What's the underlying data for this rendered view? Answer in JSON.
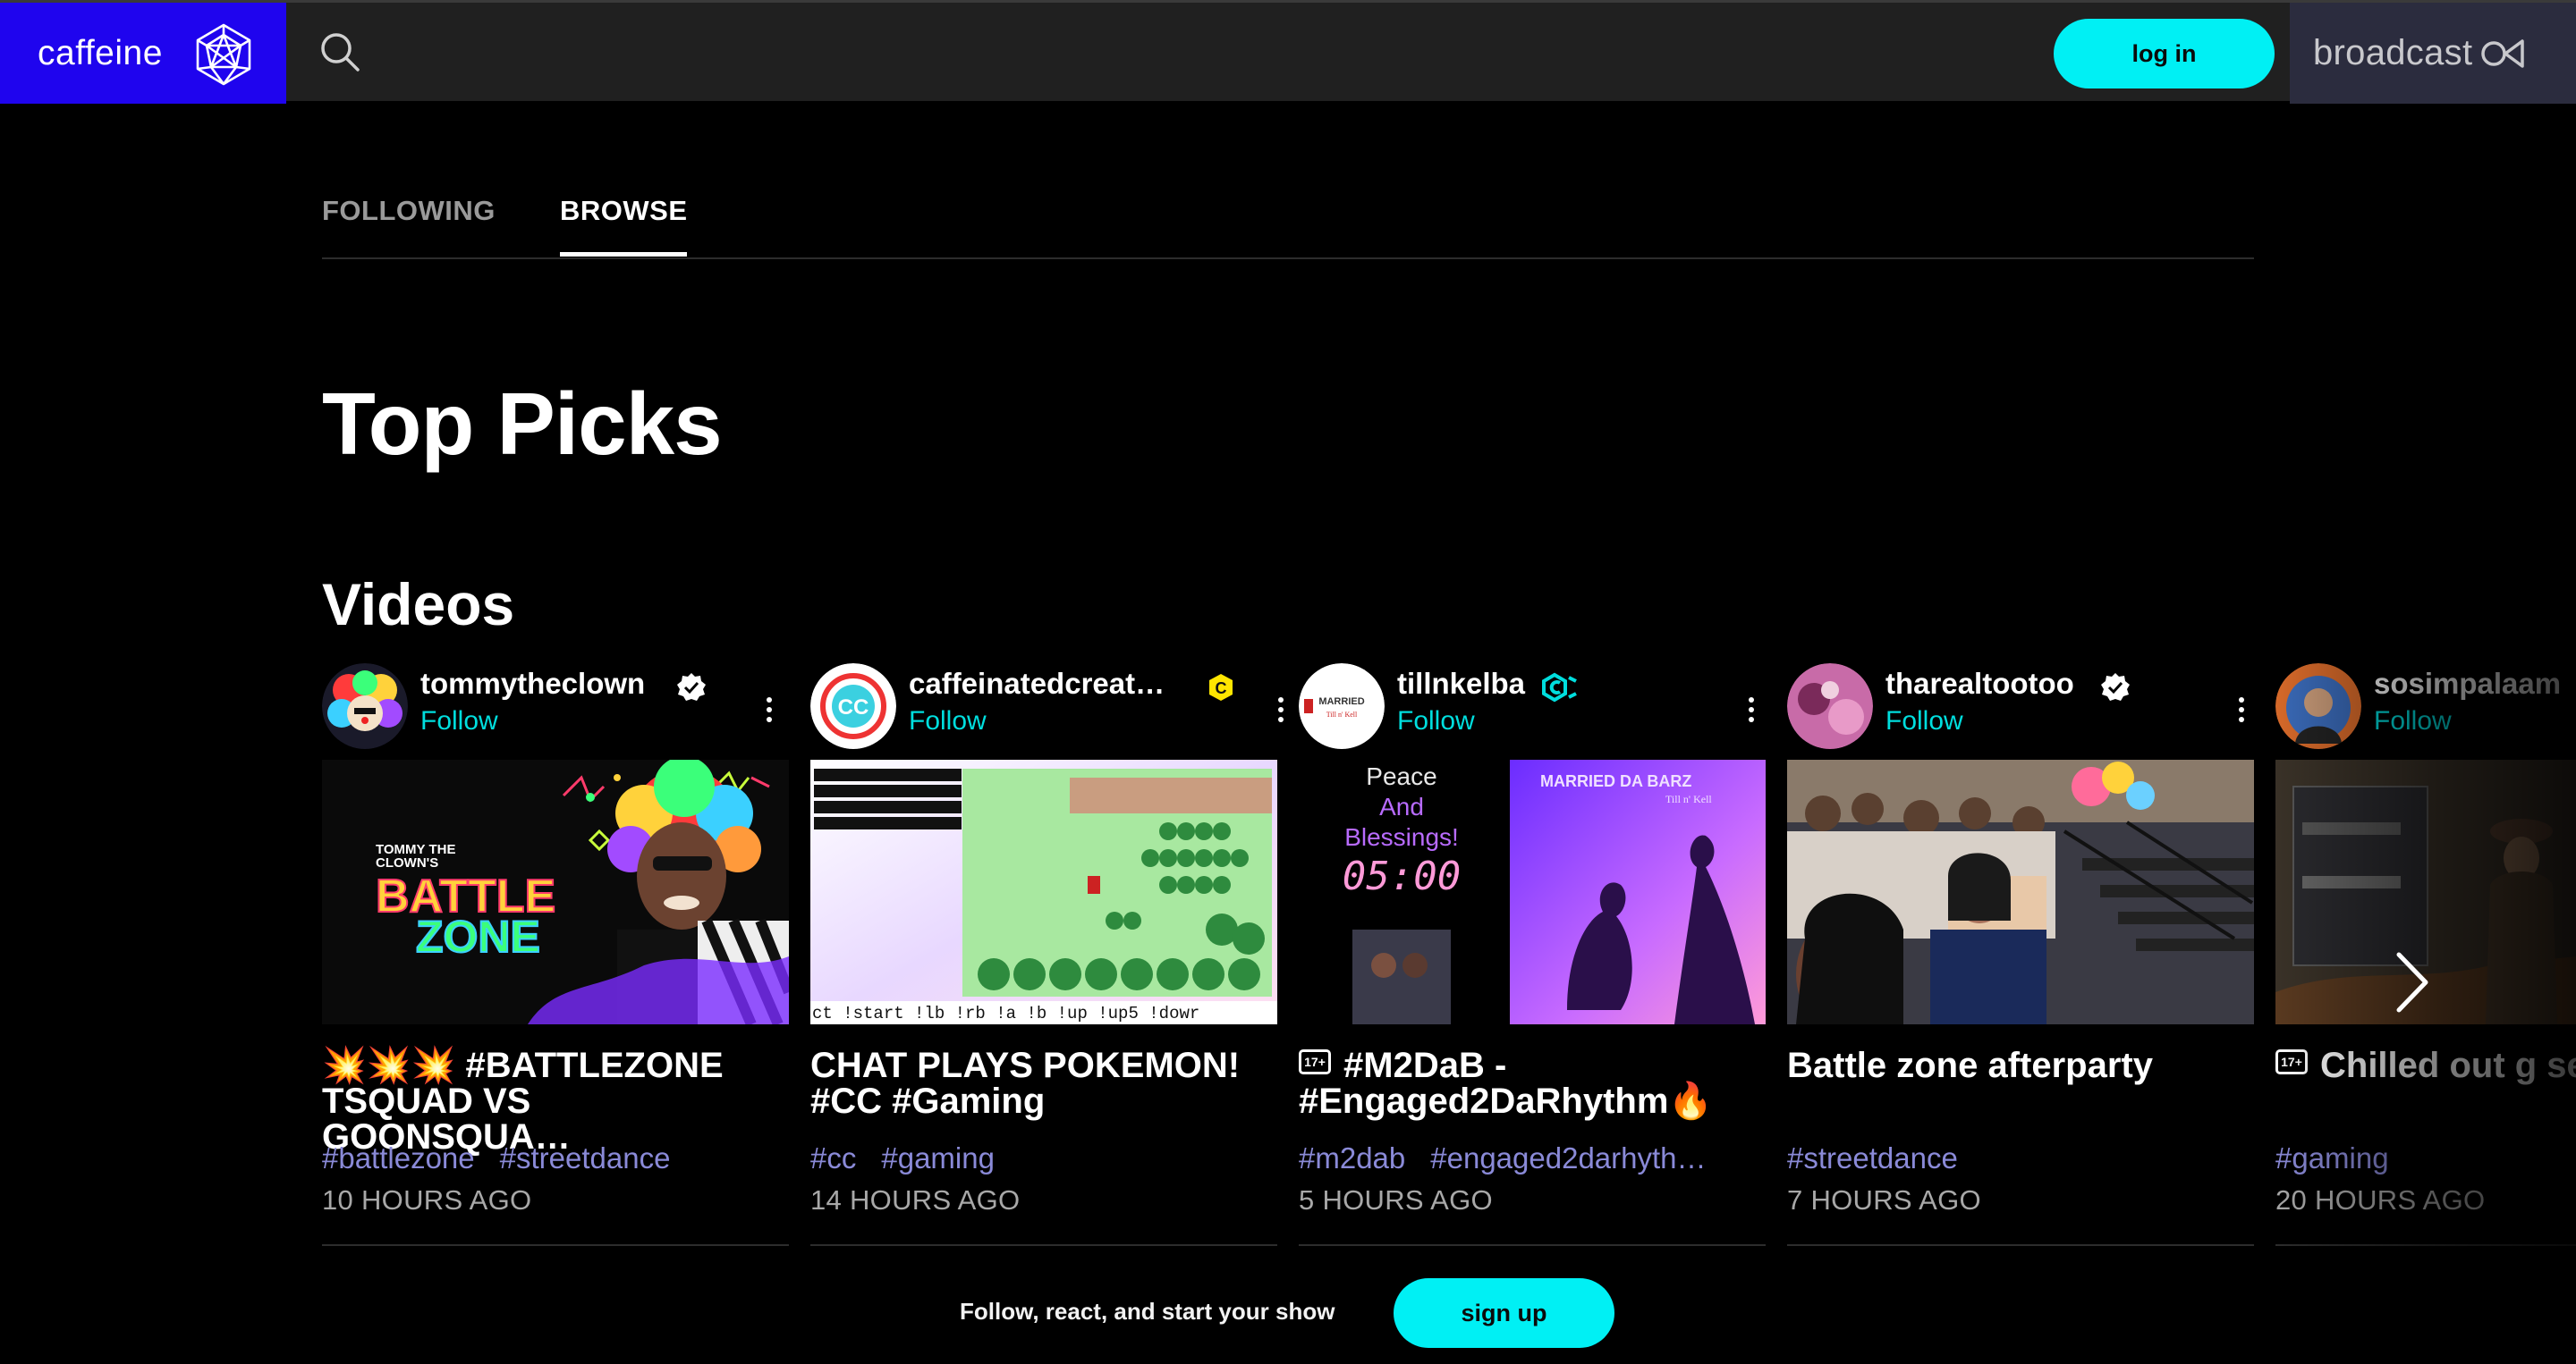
{
  "brand": {
    "name": "caffeine",
    "accent": "#00f0f4",
    "brand_blue": "#1f04ee"
  },
  "header": {
    "login_label": "log in",
    "broadcast_label": "broadcast",
    "search_icon": "search-icon"
  },
  "tabs": [
    {
      "label": "FOLLOWING",
      "active": false
    },
    {
      "label": "BROWSE",
      "active": true
    }
  ],
  "main": {
    "heading": "Top Picks",
    "section_heading": "Videos"
  },
  "videos": [
    {
      "username": "tommytheclown",
      "follow_label": "Follow",
      "verified": true,
      "title": "💥💥💥 #BATTLEZONE TSQUAD VS GOONSQUA…",
      "tags": [
        "#battlezone",
        "#streetdance"
      ],
      "time": "10 HOURS AGO",
      "thumb_text": {
        "line1": "TOMMY THE",
        "line2": "CLOWN'S",
        "line3": "BATTLE",
        "line4": "ZONE"
      }
    },
    {
      "username": "caffeinatedcreat…",
      "follow_label": "Follow",
      "verified": false,
      "title": "CHAT PLAYS POKEMON! #CC #Gaming",
      "tags": [
        "#cc",
        "#gaming"
      ],
      "time": "14 HOURS AGO",
      "thumb_text": {
        "bottom": "ct !start !lb !rb !a !b !up !up5 !dowr",
        "avatar_text": "CC"
      }
    },
    {
      "username": "tillnkelba",
      "follow_label": "Follow",
      "verified": false,
      "age_badge": "17+",
      "title": "#M2DaB - #Engaged2DaRhythm🔥",
      "tags": [
        "#m2dab",
        "#engaged2darhyth…"
      ],
      "time": "5 HOURS AGO",
      "thumb_text": {
        "peace": "Peace",
        "and": "And",
        "blessings": "Blessings!",
        "timer": "05:00",
        "poster": "MARRIED DA BARZ",
        "poster_sub": "Till n' Kell"
      }
    },
    {
      "username": "tharealtootoo",
      "follow_label": "Follow",
      "verified": true,
      "title": "Battle zone afterparty",
      "tags": [
        "#streetdance"
      ],
      "time": "7 HOURS AGO"
    },
    {
      "username": "sosimpalaam",
      "follow_label": "Follow",
      "verified": false,
      "age_badge": "17+",
      "title": "Chilled out g session",
      "tags": [
        "#gaming"
      ],
      "time": "20 HOURS AGO"
    }
  ],
  "footer": {
    "prompt": "Follow, react, and start your show",
    "signup_label": "sign up"
  }
}
